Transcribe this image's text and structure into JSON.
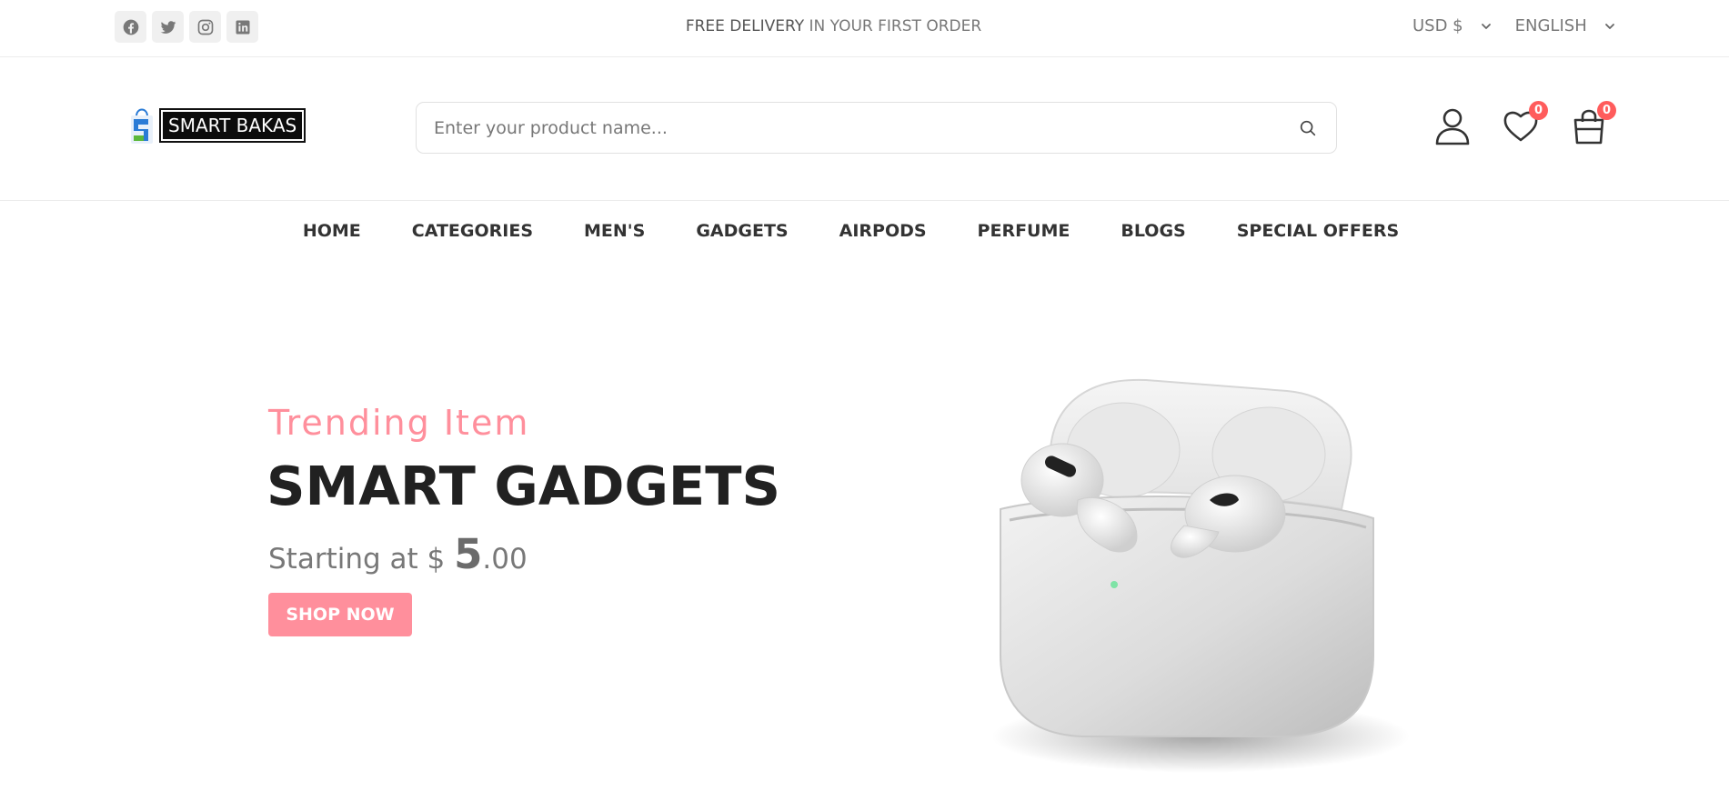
{
  "topbar": {
    "socials": [
      "facebook-icon",
      "twitter-icon",
      "instagram-icon",
      "linkedin-icon"
    ],
    "promo_bold": "FREE DELIVERY",
    "promo_rest": " IN YOUR FIRST ORDER",
    "currency": "USD $",
    "language": "ENGLISH"
  },
  "header": {
    "logo_text": "SMART BAKAS",
    "search_placeholder": "Enter your product name...",
    "wishlist_count": "0",
    "cart_count": "0"
  },
  "nav": {
    "items": [
      "HOME",
      "CATEGORIES",
      "MEN'S",
      "GADGETS",
      "AIRPODS",
      "PERFUME",
      "BLOGS",
      "SPECIAL OFFERS"
    ]
  },
  "hero": {
    "subtitle": "Trending Item",
    "title": "SMART GADGETS",
    "price_prefix": "Starting at $ ",
    "price_whole": "5",
    "price_cents": ".00",
    "button_label": "SHOP NOW"
  },
  "colors": {
    "accent": "#ff8f9c",
    "badge": "#ff5c5c",
    "text_dark": "#212121",
    "text_muted": "#787878"
  }
}
